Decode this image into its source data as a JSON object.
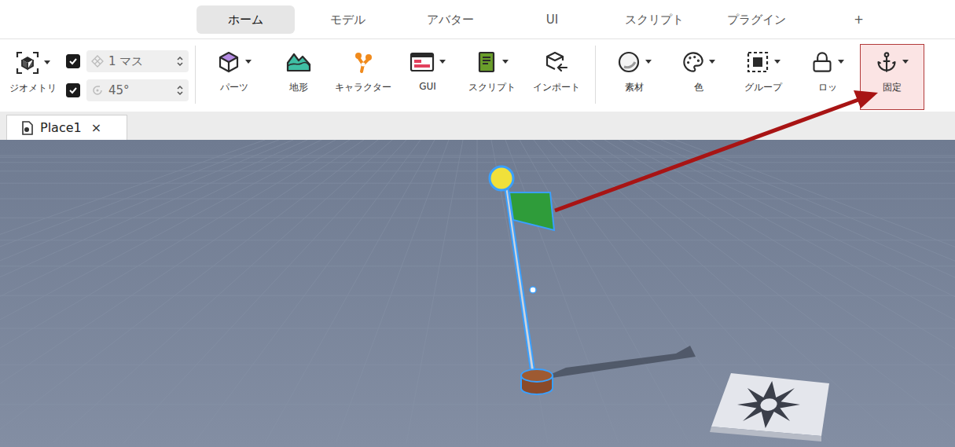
{
  "tabs": [
    {
      "label": "ホーム",
      "selected": true
    },
    {
      "label": "モデル",
      "selected": false
    },
    {
      "label": "アバター",
      "selected": false
    },
    {
      "label": "UI",
      "selected": false
    },
    {
      "label": "スクリプト",
      "selected": false
    },
    {
      "label": "プラグイン",
      "selected": false
    },
    {
      "label": "+",
      "selected": false
    }
  ],
  "geometry": {
    "label": "ジオメトリ",
    "dropdown": true,
    "snaps": [
      {
        "checked": true,
        "value": "1 マス"
      },
      {
        "checked": true,
        "value": "45°"
      }
    ]
  },
  "tool_groups": [
    [
      {
        "label": "パーツ",
        "dropdown": true,
        "highlighted": false
      },
      {
        "label": "地形",
        "dropdown": false,
        "highlighted": false
      },
      {
        "label": "キャラクター",
        "dropdown": false,
        "highlighted": false
      },
      {
        "label": "GUI",
        "dropdown": true,
        "highlighted": false
      },
      {
        "label": "スクリプト",
        "dropdown": true,
        "highlighted": false
      },
      {
        "label": "インポート",
        "dropdown": false,
        "highlighted": false
      }
    ],
    [
      {
        "label": "素材",
        "dropdown": true,
        "highlighted": false
      },
      {
        "label": "色",
        "dropdown": true,
        "highlighted": false
      },
      {
        "label": "グループ",
        "dropdown": true,
        "highlighted": false
      },
      {
        "label": "ロッ",
        "dropdown": true,
        "highlighted": false
      },
      {
        "label": "固定",
        "dropdown": true,
        "highlighted": true
      }
    ]
  ],
  "document_tabs": [
    {
      "label": "Place1",
      "close": "×",
      "selected": true
    }
  ]
}
